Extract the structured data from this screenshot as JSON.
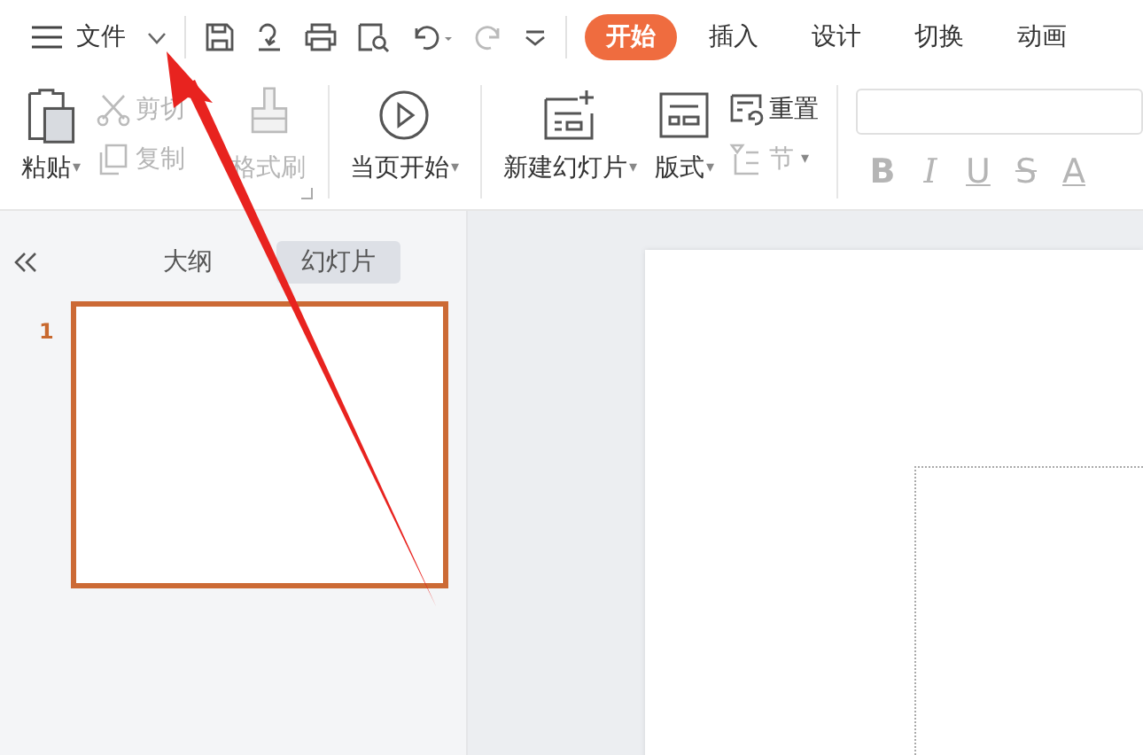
{
  "menu": {
    "label": "文件"
  },
  "tabs": [
    {
      "label": "开始",
      "selected": true
    },
    {
      "label": "插入",
      "selected": false
    },
    {
      "label": "设计",
      "selected": false
    },
    {
      "label": "切换",
      "selected": false
    },
    {
      "label": "动画",
      "selected": false
    }
  ],
  "ribbon": {
    "paste": {
      "label": "粘贴",
      "caret": "▾",
      "disabled": false
    },
    "cut": {
      "label": "剪切",
      "disabled": true
    },
    "copy": {
      "label": "复制",
      "disabled": true
    },
    "format_painter": {
      "label": "格式刷",
      "disabled": true
    },
    "play_from_current": {
      "label": "当页开始",
      "caret": "▾",
      "disabled": false
    },
    "new_slide": {
      "label": "新建幻灯片",
      "caret": "▾",
      "disabled": false
    },
    "layout": {
      "label": "版式",
      "caret": "▾",
      "disabled": false
    },
    "reset": {
      "label": "重置",
      "disabled": false
    },
    "section": {
      "label": "节",
      "caret": "▾",
      "disabled": true
    },
    "format_buttons": [
      {
        "label": "B",
        "kind": "bold",
        "disabled": true
      },
      {
        "label": "I",
        "kind": "italic",
        "disabled": true
      },
      {
        "label": "U",
        "kind": "underline",
        "disabled": true
      },
      {
        "label": "S",
        "kind": "strike",
        "disabled": true
      },
      {
        "label": "A",
        "kind": "color",
        "disabled": true
      }
    ]
  },
  "panel": {
    "view_tabs": [
      {
        "label": "大纲",
        "selected": false
      },
      {
        "label": "幻灯片",
        "selected": true
      }
    ],
    "slides": [
      {
        "number": "1",
        "selected": true
      }
    ]
  }
}
